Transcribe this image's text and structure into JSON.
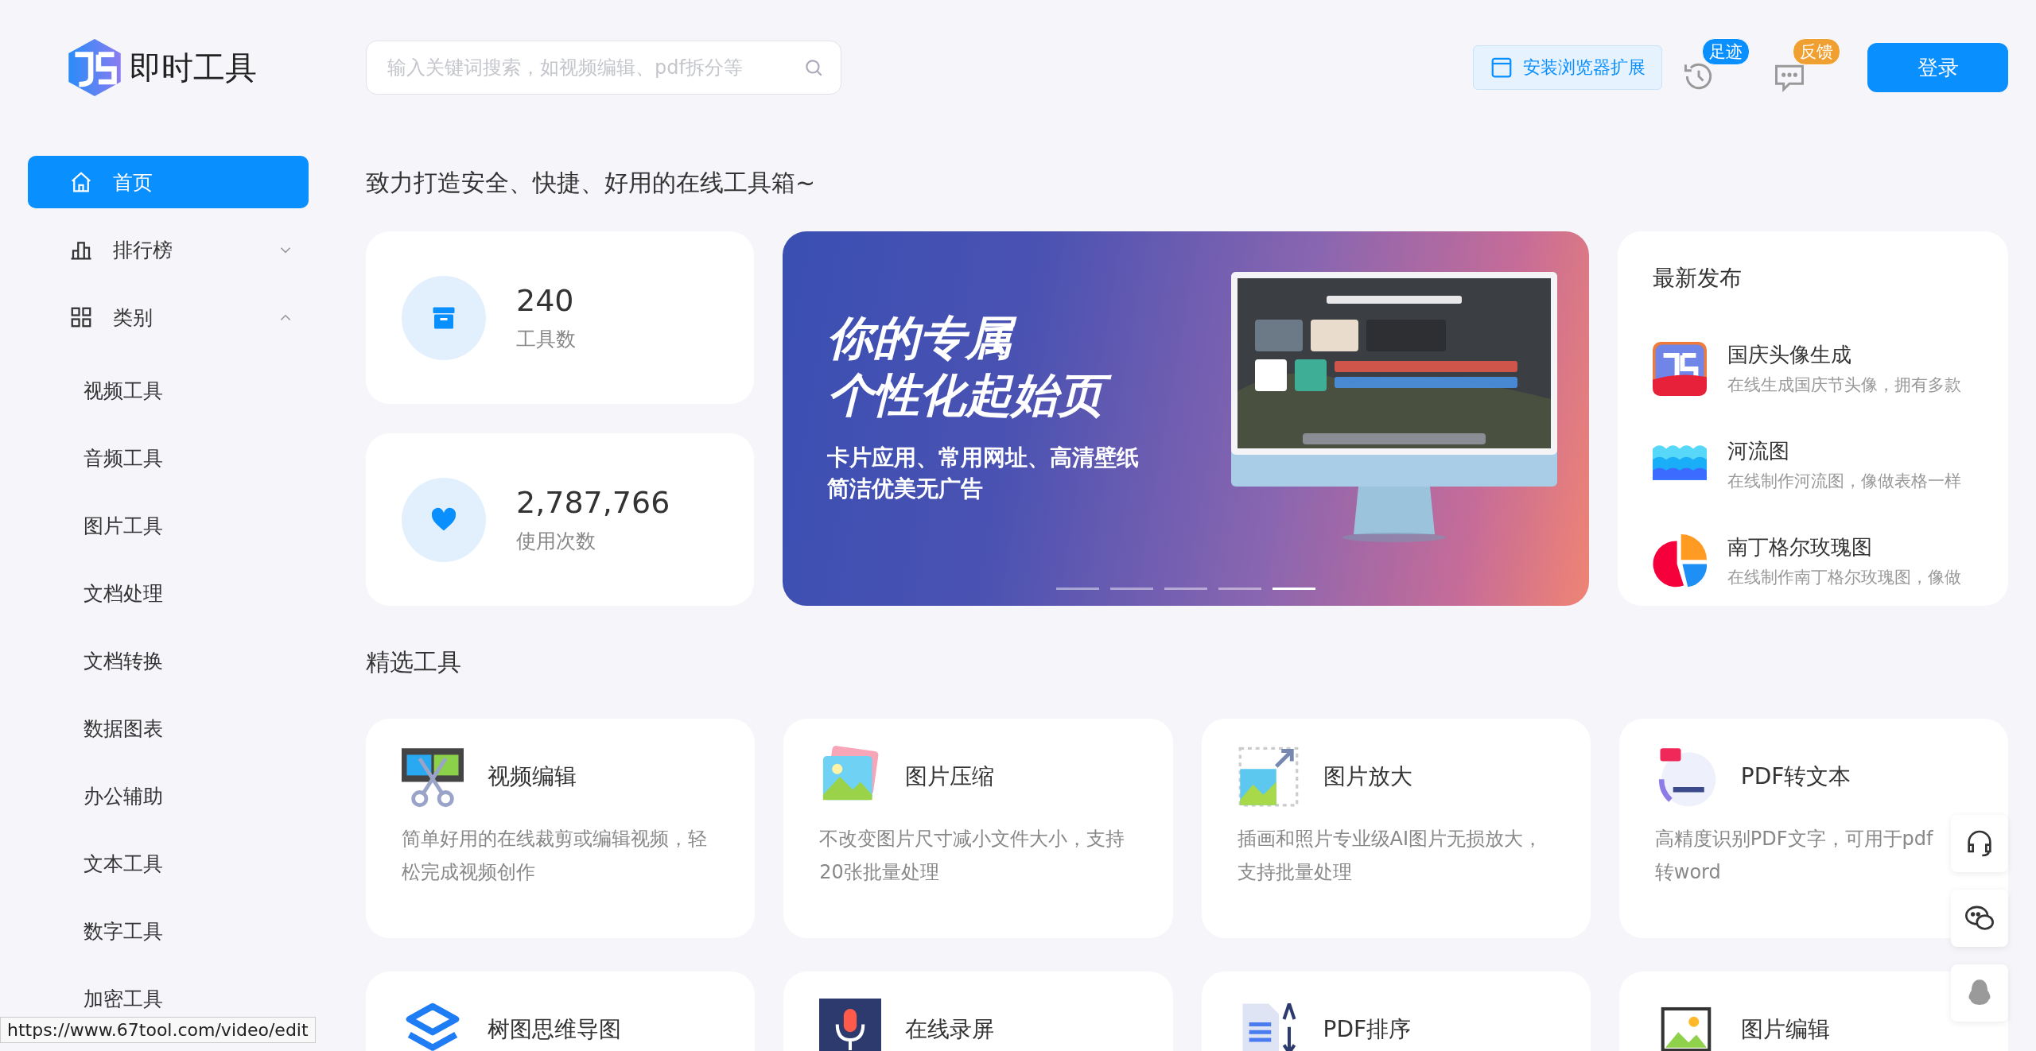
{
  "header": {
    "logo_text": "即时工具",
    "search": {
      "placeholder": "输入关键词搜索，如视频编辑、pdf拆分等"
    },
    "extension_button": "安装浏览器扩展",
    "history_badge": "足迹",
    "feedback_badge": "反馈",
    "login_button": "登录"
  },
  "sidebar": {
    "items": [
      {
        "kind": "home",
        "label": "首页",
        "selected": true
      },
      {
        "kind": "ranking",
        "label": "排行榜",
        "selected": false,
        "expanded": false
      },
      {
        "kind": "category",
        "label": "类别",
        "selected": false,
        "expanded": true,
        "children": [
          {
            "label": "视频工具",
            "selected": false
          },
          {
            "label": "音频工具",
            "selected": false
          },
          {
            "label": "图片工具",
            "selected": false
          },
          {
            "label": "文档处理",
            "selected": false
          },
          {
            "label": "文档转换",
            "selected": false
          },
          {
            "label": "数据图表",
            "selected": false
          },
          {
            "label": "办公辅助",
            "selected": false
          },
          {
            "label": "文本工具",
            "selected": false
          },
          {
            "label": "数字工具",
            "selected": false
          },
          {
            "label": "加密工具",
            "selected": false
          }
        ]
      }
    ]
  },
  "tagline": "致力打造安全、快捷、好用的在线工具箱~",
  "stats": [
    {
      "kind": "box",
      "value": "240",
      "label": "工具数"
    },
    {
      "kind": "heart",
      "value": "2,787,766",
      "label": "使用次数"
    }
  ],
  "banner": {
    "title_lines": [
      "你的专属",
      "个性化起始页"
    ],
    "subtitle_lines": [
      "卡片应用、常用网址、高清壁纸",
      "简洁优美无广告"
    ],
    "slides": [
      {
        "selected": false
      },
      {
        "selected": false
      },
      {
        "selected": false
      },
      {
        "selected": false
      },
      {
        "selected": true
      }
    ]
  },
  "latest": {
    "title": "最新发布",
    "items": [
      {
        "kind": "badge",
        "name": "国庆头像生成",
        "description": "在线生成国庆节头像，拥有多款"
      },
      {
        "kind": "wave",
        "name": "河流图",
        "description": "在线制作河流图，像做表格一样"
      },
      {
        "kind": "pie",
        "name": "南丁格尔玫瑰图",
        "description": "在线制作南丁格尔玫瑰图，像做"
      }
    ]
  },
  "featured": {
    "title": "精选工具",
    "tools": [
      {
        "kind": "film",
        "name": "视频编辑",
        "description": "简单好用的在线裁剪或编辑视频，轻松完成视频创作"
      },
      {
        "kind": "photos",
        "name": "图片压缩",
        "description": "不改变图片尺寸减小文件大小，支持20张批量处理"
      },
      {
        "kind": "enlarge",
        "name": "图片放大",
        "description": "插画和照片专业级AI图片无损放大，支持批量处理"
      },
      {
        "kind": "ocr",
        "name": "PDF转文本",
        "description": "高精度识别PDF文字，可用于pdf转word"
      },
      {
        "kind": "layers",
        "name": "树图思维导图"
      },
      {
        "kind": "mic",
        "name": "在线录屏"
      },
      {
        "kind": "doc",
        "name": "PDF排序"
      },
      {
        "kind": "frame",
        "name": "图片编辑"
      }
    ]
  },
  "float_buttons": [
    {
      "kind": "headset"
    },
    {
      "kind": "chat"
    },
    {
      "kind": "penguin"
    }
  ],
  "status_url": "https://www.67tool.com/video/edit"
}
